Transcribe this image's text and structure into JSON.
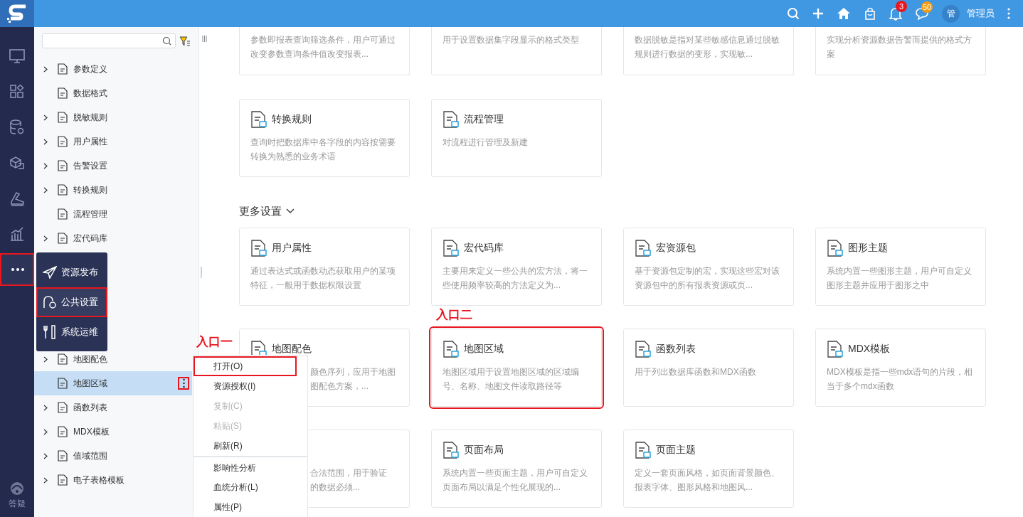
{
  "topbar": {
    "notification_count": "3",
    "message_count": "50",
    "avatar": "管",
    "user": "管理员"
  },
  "rail": {
    "items": [
      {
        "kind": "monitor",
        "selected": false,
        "highlighted": false
      },
      {
        "kind": "apps",
        "selected": false,
        "highlighted": false
      },
      {
        "kind": "database",
        "selected": false,
        "highlighted": false
      },
      {
        "kind": "cubes",
        "selected": false,
        "highlighted": false
      },
      {
        "kind": "tool",
        "selected": false,
        "highlighted": false
      },
      {
        "kind": "chart",
        "selected": false,
        "highlighted": false
      },
      {
        "kind": "more",
        "selected": true,
        "highlighted": true
      }
    ],
    "help": "答疑"
  },
  "flyout": [
    {
      "label": "资源发布",
      "kind": "send",
      "selected": false,
      "highlighted": false
    },
    {
      "label": "公共设置",
      "kind": "settings",
      "selected": true,
      "highlighted": true
    },
    {
      "label": "系统运维",
      "kind": "tools",
      "selected": false,
      "highlighted": false
    }
  ],
  "tree": {
    "items_above": [
      {
        "label": "参数定义",
        "expandable": true,
        "selected": false
      },
      {
        "label": "数据格式",
        "expandable": false,
        "selected": false
      },
      {
        "label": "脱敏规则",
        "expandable": true,
        "selected": false
      },
      {
        "label": "用户属性",
        "expandable": true,
        "selected": false
      },
      {
        "label": "告警设置",
        "expandable": true,
        "selected": false
      },
      {
        "label": "转换规则",
        "expandable": true,
        "selected": false
      },
      {
        "label": "流程管理",
        "expandable": false,
        "selected": false
      },
      {
        "label": "宏代码库",
        "expandable": true,
        "selected": false
      }
    ],
    "items_below": [
      {
        "label": "地图配色",
        "expandable": true,
        "selected": false
      },
      {
        "label": "地图区域",
        "expandable": false,
        "selected": true,
        "menu_button": {
          "highlighted": true
        }
      },
      {
        "label": "函数列表",
        "expandable": true,
        "selected": false
      },
      {
        "label": "MDX模板",
        "expandable": true,
        "selected": false
      },
      {
        "label": "值域范围",
        "expandable": true,
        "selected": false
      },
      {
        "label": "电子表格模板",
        "expandable": true,
        "selected": false
      }
    ]
  },
  "context_menu": [
    {
      "label": "打开(O)",
      "disabled": false,
      "highlighted": true,
      "separator_before": false
    },
    {
      "label": "资源授权(I)",
      "disabled": false,
      "highlighted": false,
      "separator_before": false
    },
    {
      "label": "复制(C)",
      "disabled": true,
      "highlighted": false,
      "separator_before": false
    },
    {
      "label": "粘贴(S)",
      "disabled": true,
      "highlighted": false,
      "separator_before": false
    },
    {
      "label": "刷新(R)",
      "disabled": false,
      "highlighted": false,
      "separator_before": false
    },
    {
      "label": "影响性分析",
      "disabled": false,
      "highlighted": false,
      "separator_before": true
    },
    {
      "label": "血统分析(L)",
      "disabled": false,
      "highlighted": false,
      "separator_before": false
    },
    {
      "label": "属性(P)",
      "disabled": false,
      "highlighted": false,
      "separator_before": false
    }
  ],
  "main": {
    "top_cards": [
      {
        "description": [
          "参数即报表查询筛选条件，用户可通过",
          "改变参数查询条件值改变报表..."
        ]
      },
      {
        "description": [
          "用于设置数据集字段显示的格式类型"
        ]
      },
      {
        "description": [
          "数据脱敏是指对某些敏感信息通过脱敏",
          "规则进行数据的变形，实现敏..."
        ]
      },
      {
        "description": [
          "实现分析资源数据告警而提供的格式方",
          "案"
        ]
      }
    ],
    "cards": [
      {
        "title": "转换规则",
        "description": [
          "查询时把数据库中各字段的内容按需要",
          "转换为熟悉的业务术语"
        ],
        "highlighted": false,
        "covered": false
      },
      {
        "title": "流程管理",
        "description": [
          "对流程进行管理及新建"
        ],
        "highlighted": false,
        "covered": false
      }
    ],
    "section": {
      "title": "更多设置",
      "expanded": true
    },
    "more_cards": [
      {
        "title": "用户属性",
        "description": [
          "通过表达式或函数动态获取用户的某项",
          "特征，一般用于数据权限设置"
        ],
        "highlighted": false,
        "covered": false
      },
      {
        "title": "宏代码库",
        "description": [
          "主要用来定义一些公共的宏方法，将一",
          "些使用频率较高的方法定义为..."
        ],
        "highlighted": false,
        "covered": false
      },
      {
        "title": "宏资源包",
        "description": [
          "基于资源包定制的宏，实现这些宏对该",
          "资源包中的所有报表资源或页..."
        ],
        "highlighted": false,
        "covered": false
      },
      {
        "title": "图形主题",
        "description": [
          "系统内置一些图形主题，用户可自定义",
          "图形主题并应用于图形之中"
        ],
        "highlighted": false,
        "covered": false
      },
      {
        "title": "地图配色",
        "description": [
          "颜色序列，应用于地图",
          "图配色方案，..."
        ],
        "highlighted": false,
        "covered": true
      },
      {
        "title": "地图区域",
        "description": [
          "地图区域用于设置地图区域的区域编",
          "号、名称、地图文件读取路径等"
        ],
        "highlighted": true,
        "covered": false
      },
      {
        "title": "函数列表",
        "description": [
          "用于列出数据库函数和MDX函数"
        ],
        "highlighted": false,
        "covered": false
      },
      {
        "title": "MDX模板",
        "description": [
          "MDX模板是指一些mdx语句的片段，相",
          "当于多个mdx函数"
        ],
        "highlighted": false,
        "covered": false
      },
      {
        "description": [
          "合法范围，用于验证",
          "的数据必须..."
        ],
        "highlighted": false,
        "covered": true
      },
      {
        "title": "页面布局",
        "description": [
          "系统内置一些页面主题，用户可自定义",
          "页面布局以满足个性化展现的..."
        ],
        "highlighted": false,
        "covered": false
      },
      {
        "title": "页面主题",
        "description": [
          "定义一套页面风格，如页面背景颜色、",
          "报表字体、图形风格和地图风..."
        ],
        "highlighted": false,
        "covered": false
      }
    ]
  },
  "annotations": [
    {
      "label": "入口一"
    },
    {
      "label": "入口二"
    }
  ]
}
